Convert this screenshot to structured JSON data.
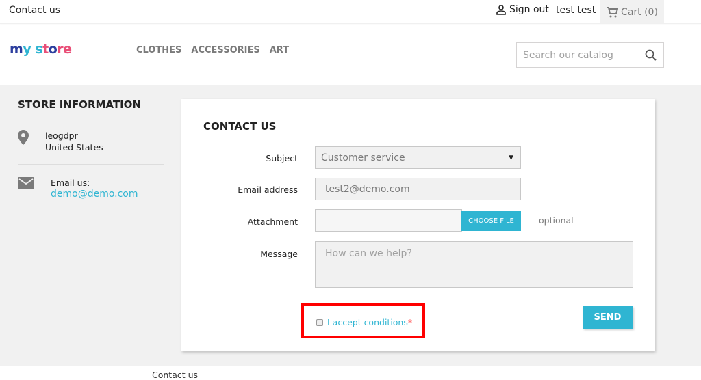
{
  "topbar": {
    "contact": "Contact us",
    "sign_out": "Sign out",
    "user": "test test",
    "cart": "Cart (0)"
  },
  "header": {
    "logo": "my store",
    "nav": [
      "CLOTHES",
      "ACCESSORIES",
      "ART"
    ],
    "search_placeholder": "Search our catalog"
  },
  "store_info": {
    "title": "STORE INFORMATION",
    "name": "leogdpr",
    "country": "United States",
    "email_label": "Email us:",
    "email": "demo@demo.com"
  },
  "form": {
    "title": "CONTACT US",
    "subject_label": "Subject",
    "subject_value": "Customer service",
    "email_label": "Email address",
    "email_value": "test2@demo.com",
    "attachment_label": "Attachment",
    "choose_file": "CHOOSE FILE",
    "optional": "optional",
    "message_label": "Message",
    "message_placeholder": "How can we help?",
    "conditions": "I accept conditions",
    "required_mark": "*",
    "send": "SEND"
  },
  "footer": {
    "link": "Contact us"
  },
  "colors": {
    "accent": "#2fb5d2",
    "highlight": "#ff0000",
    "background": "#f1f1f1"
  }
}
